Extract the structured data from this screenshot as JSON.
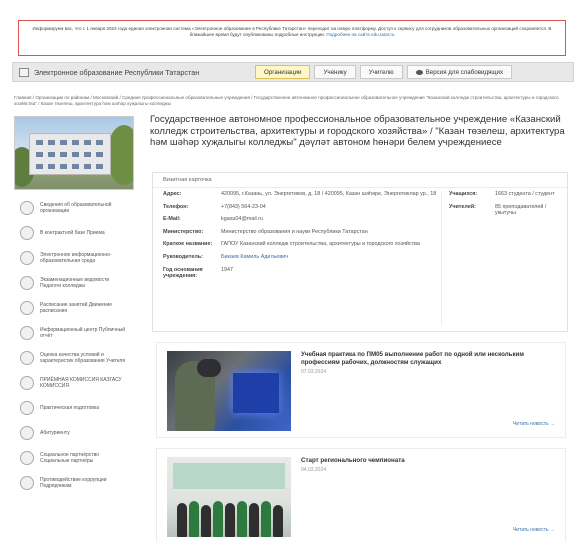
{
  "notice": {
    "text": "Информируем вас, что с 1 января 2024 года единая электронная система «Электронное образование в Республике Татарстан» переходит на новую платформу. Доступ к сервису для сотрудников образовательных организаций сохраняется. В ближайшее время будут опубликованы подробные инструкции.",
    "link": "Подробнее на сайте edu.tatar.ru"
  },
  "topbar": {
    "site_name": "Электронное образование Республики Татарстан",
    "tabs": [
      "Организации",
      "Ученику",
      "Учителю"
    ],
    "accessibility_label": "Версия для слабовидящих"
  },
  "breadcrumbs": "Главная / Организации по районам / Московский / Средние профессиональные образовательные учреждения / Государственное автономное профессиональное образовательное учреждение \"Казанский колледж строительства, архитектуры и городского хозяйства\" / Казан төзелеш, архитектура һәм шәһәр хуҗалыгы колледжы",
  "sidebar": {
    "items": [
      {
        "label": "Сведения об образовательной организации"
      },
      {
        "label": "В контрактной базе Приема"
      },
      {
        "label": "Электронное информационно-образовательная среда"
      },
      {
        "label": "Экзаменационные ведомости Педагоги колледжа"
      },
      {
        "label": "Расписание занятий Движение расписания"
      },
      {
        "label": "Информационный центр Публичный отчёт"
      },
      {
        "label": "Оценка качества условий и характеристик образования Учителя"
      },
      {
        "label": "ПРИЁМНАЯ КОМИССИЯ КАЗГАСУ КОМИССИЯ"
      },
      {
        "label": "Практическая подготовка"
      },
      {
        "label": "Абитуриенту"
      },
      {
        "label": "Социальное партнёрство Социальные партнёры"
      },
      {
        "label": "Противодействие коррупции Подрядчикам"
      }
    ]
  },
  "main": {
    "title": "Государственное автономное профессиональное образовательное учреждение «Казанский колледж строительства, архитектуры и городского хозяйства» / \"Казан төзелеш, архитектура һәм шәһәр хуҗалыгы колледжы\" дәүләт автоном һөнәри белем учреждениесе",
    "card": {
      "heading": "Визитная карточка",
      "fields": [
        {
          "key": "Адрес:",
          "value": "420095, г.Казань, ул. Энергетиков, д. 18 / 420095, Казан шәһәре, Энергетиклар ур., 18"
        },
        {
          "key": "Телефон:",
          "value": "+7(843) 564-23-04"
        },
        {
          "key": "E-Mail:",
          "value": "kgasu04@mail.ru"
        },
        {
          "key": "Министерство:",
          "value": "Министерство образования и науки Республики Татарстан"
        },
        {
          "key": "Краткое название:",
          "value": "ГАПОУ Казанский колледж строительства, архитектуры и городского хозяйства"
        },
        {
          "key": "Руководитель:",
          "value": "Бикаев Камиль Адильевич"
        },
        {
          "key": "Год основания учреждения:",
          "value": "1947"
        }
      ],
      "right_fields": [
        {
          "key": "Учащихся:",
          "value": "1663 студента / студент"
        },
        {
          "key": "Учителей:",
          "value": "85 преподавателей / укытучы"
        }
      ]
    },
    "news": [
      {
        "title": "Учебная практика по ПМ05 выполнение работ по одной или нескольким профессиям рабочих, должностям служащих",
        "date": "07.03.2024",
        "more": "Читать новость →"
      },
      {
        "title": "Старт регионального чемпионата",
        "date": "04.03.2024",
        "more": "Читать новость →"
      }
    ]
  },
  "colors": {
    "notice_border": "#d9534f",
    "active_tab": "#fff8c6",
    "link": "#3a6ea5"
  }
}
